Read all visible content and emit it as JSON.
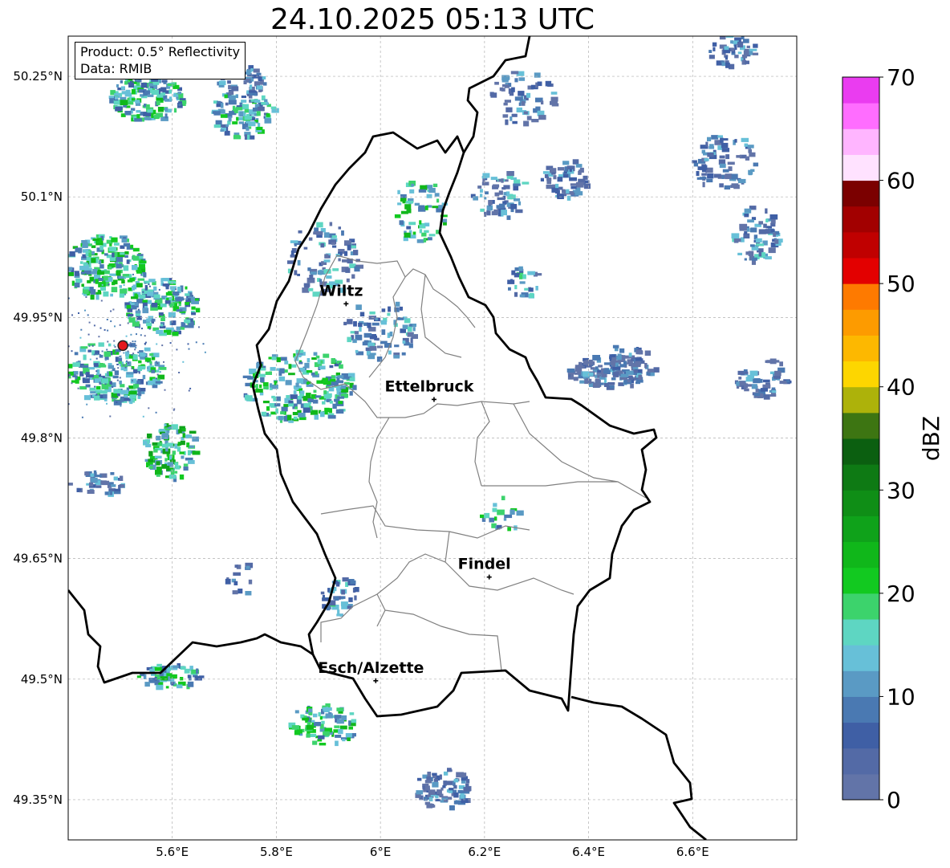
{
  "title": "24.10.2025 05:13 UTC",
  "info_box": {
    "product": "Product: 0.5° Reflectivity",
    "data": "Data: RMIB"
  },
  "map": {
    "lon_range": [
      5.4,
      6.8
    ],
    "lat_range": [
      49.3,
      50.3
    ],
    "lon_ticks": [
      {
        "value": 5.6,
        "label": "5.6°E"
      },
      {
        "value": 5.8,
        "label": "5.8°E"
      },
      {
        "value": 6.0,
        "label": "6°E"
      },
      {
        "value": 6.2,
        "label": "6.2°E"
      },
      {
        "value": 6.4,
        "label": "6.4°E"
      },
      {
        "value": 6.6,
        "label": "6.6°E"
      }
    ],
    "lat_ticks": [
      {
        "value": 49.35,
        "label": "49.35°N"
      },
      {
        "value": 49.5,
        "label": "49.5°N"
      },
      {
        "value": 49.65,
        "label": "49.65°N"
      },
      {
        "value": 49.8,
        "label": "49.8°N"
      },
      {
        "value": 49.95,
        "label": "49.95°N"
      },
      {
        "value": 50.1,
        "label": "50.1°N"
      },
      {
        "value": 50.25,
        "label": "50.25°N"
      }
    ],
    "radar_site": {
      "lon": 5.505,
      "lat": 49.915
    },
    "cities": [
      {
        "name": "Wiltz",
        "lon": 5.934,
        "lat": 49.967
      },
      {
        "name": "Ettelbruck",
        "lon": 6.103,
        "lat": 49.848
      },
      {
        "name": "Findel",
        "lon": 6.209,
        "lat": 49.627
      },
      {
        "name": "Esch/Alzette",
        "lon": 5.991,
        "lat": 49.498
      }
    ]
  },
  "colorbar": {
    "label": "dBZ",
    "min": 0,
    "max": 70,
    "step": 2.5,
    "ticks": [
      0,
      10,
      20,
      30,
      40,
      50,
      60,
      70
    ],
    "colors": [
      "#6274a8",
      "#536aa6",
      "#3f5fa5",
      "#4a79b2",
      "#5a9ac4",
      "#67c0d8",
      "#5ed6c2",
      "#3cd36c",
      "#12c920",
      "#10b71a",
      "#0fa21a",
      "#0f8e16",
      "#0e7a14",
      "#0b5f10",
      "#3d7512",
      "#adb20a",
      "#fdd600",
      "#fdb800",
      "#fd9b00",
      "#fe7a00",
      "#e30000",
      "#c00000",
      "#a20000",
      "#7b0000",
      "#ffe2ff",
      "#ffb5ff",
      "#ff6dff",
      "#ea3cf0"
    ]
  }
}
